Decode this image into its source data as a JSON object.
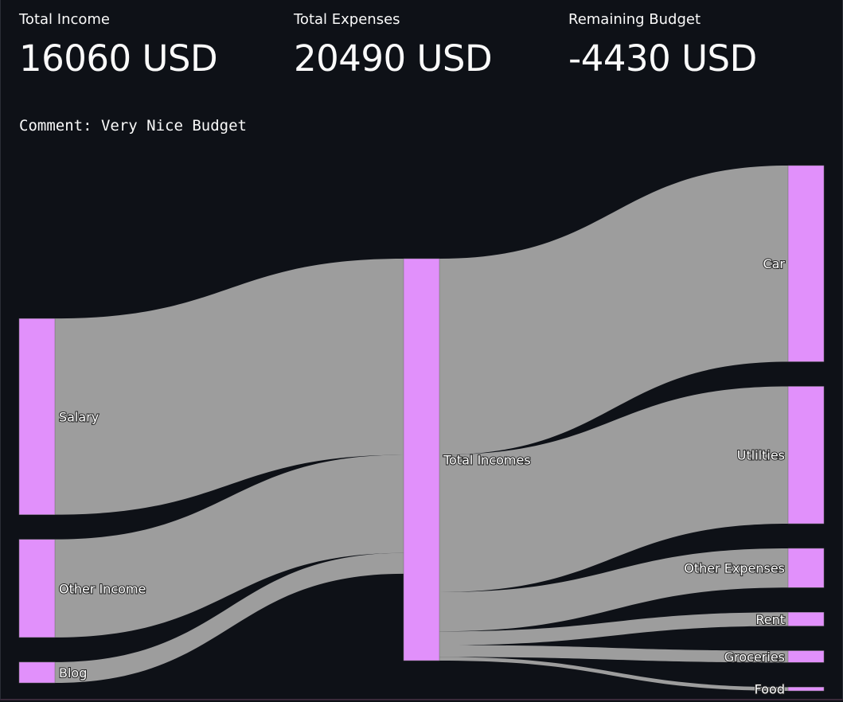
{
  "metrics": {
    "income": {
      "label": "Total Income",
      "value": "16060 USD"
    },
    "expenses": {
      "label": "Total Expenses",
      "value": "20490 USD"
    },
    "remaining": {
      "label": "Remaining Budget",
      "value": "-4430 USD"
    }
  },
  "comment": "Comment: Very Nice Budget",
  "colors": {
    "background": "#0e1117",
    "node": "#e190fb",
    "link": "#a0a0a0"
  },
  "chart_data": {
    "type": "sankey",
    "nodes": [
      "Salary",
      "Other Income",
      "Blog",
      "Total Incomes",
      "Car",
      "Utilities",
      "Other Expenses",
      "Rent",
      "Groceries",
      "Food"
    ],
    "node_labels": [
      "Salary",
      "Other Income",
      "Blog",
      "Total Incomes",
      "Car",
      "Utlilties",
      "Other Expenses",
      "Rent",
      "Groceries",
      "Food"
    ],
    "links": [
      {
        "source": "Salary",
        "target": "Total Incomes",
        "value": 10000
      },
      {
        "source": "Other Income",
        "target": "Total Incomes",
        "value": 5000
      },
      {
        "source": "Blog",
        "target": "Total Incomes",
        "value": 1060
      },
      {
        "source": "Total Incomes",
        "target": "Car",
        "value": 10000
      },
      {
        "source": "Total Incomes",
        "target": "Utilities",
        "value": 7000
      },
      {
        "source": "Total Incomes",
        "target": "Other Expenses",
        "value": 2000
      },
      {
        "source": "Total Incomes",
        "target": "Rent",
        "value": 700
      },
      {
        "source": "Total Incomes",
        "target": "Groceries",
        "value": 600
      },
      {
        "source": "Total Incomes",
        "target": "Food",
        "value": 190
      }
    ]
  }
}
